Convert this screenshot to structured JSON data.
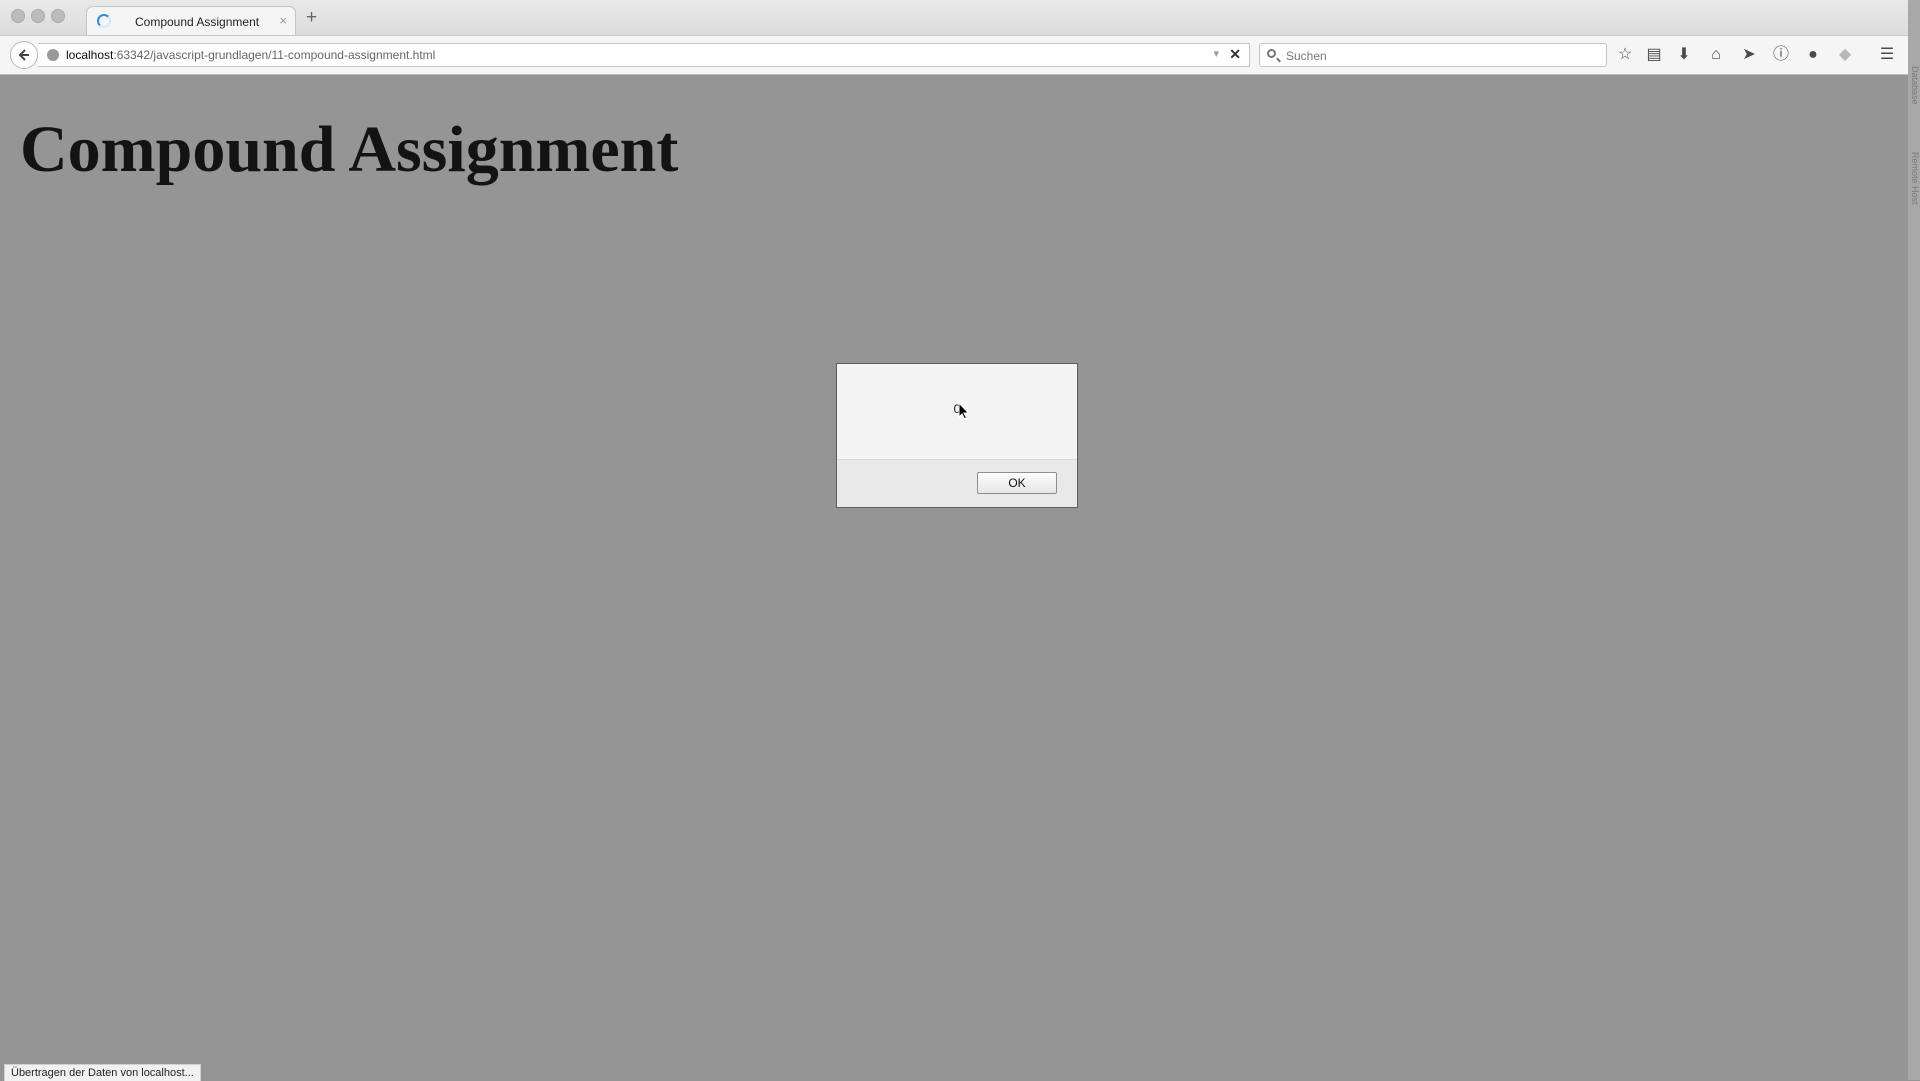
{
  "browser": {
    "tab": {
      "title": "Compound Assignment",
      "close_glyph": "×"
    },
    "new_tab_glyph": "+",
    "url": {
      "host": "localhost",
      "rest": ":63342/javascript-grundlagen/11-compound-assignment.html"
    },
    "search": {
      "placeholder": "Suchen"
    },
    "toolbar_icons": [
      "star-icon",
      "reading-list-icon",
      "download-icon",
      "home-icon",
      "send-icon",
      "info-icon",
      "chat-icon",
      "shield-icon",
      "menu-icon"
    ]
  },
  "page": {
    "heading": "Compound Assignment"
  },
  "dialog": {
    "message": "0",
    "ok_label": "OK"
  },
  "status": {
    "text": "Übertragen der Daten von localhost..."
  },
  "side_labels": [
    "Database",
    "Remote Host"
  ],
  "colors": {
    "overlay_bg": "#959595",
    "spinner_accent": "#2f8fd6"
  }
}
